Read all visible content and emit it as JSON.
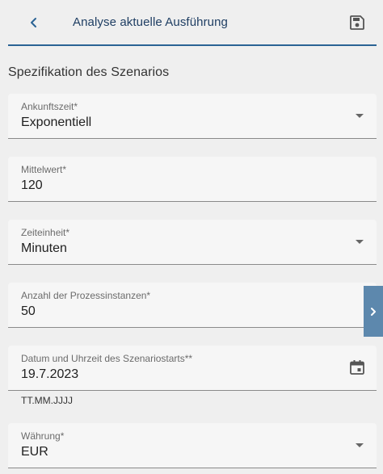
{
  "header": {
    "title": "Analyse aktuelle Ausführung"
  },
  "section": {
    "title": "Spezifikation des Szenarios"
  },
  "fields": {
    "arrival": {
      "label": "Ankunftszeit*",
      "value": "Exponentiell"
    },
    "mean": {
      "label": "Mittelwert*",
      "value": "120"
    },
    "time_unit": {
      "label": "Zeiteinheit*",
      "value": "Minuten"
    },
    "instances": {
      "label": "Anzahl der Prozessinstanzen*",
      "value": "50"
    },
    "start_date": {
      "label": "Datum und Uhrzeit des Szenariostarts**",
      "value": "19.7.2023",
      "hint": "TT.MM.JJJJ"
    },
    "currency": {
      "label": "Währung*",
      "value": "EUR"
    }
  },
  "icons": {
    "back": "chevron-left-icon",
    "save": "save-icon",
    "calendar": "calendar-icon",
    "side_tab": "chevron-right-icon"
  },
  "colors": {
    "primary": "#2a6394",
    "title": "#1f3e63",
    "side_tab": "#5d88ad",
    "background": "#efefef",
    "field_bg": "#f6f6f6"
  }
}
